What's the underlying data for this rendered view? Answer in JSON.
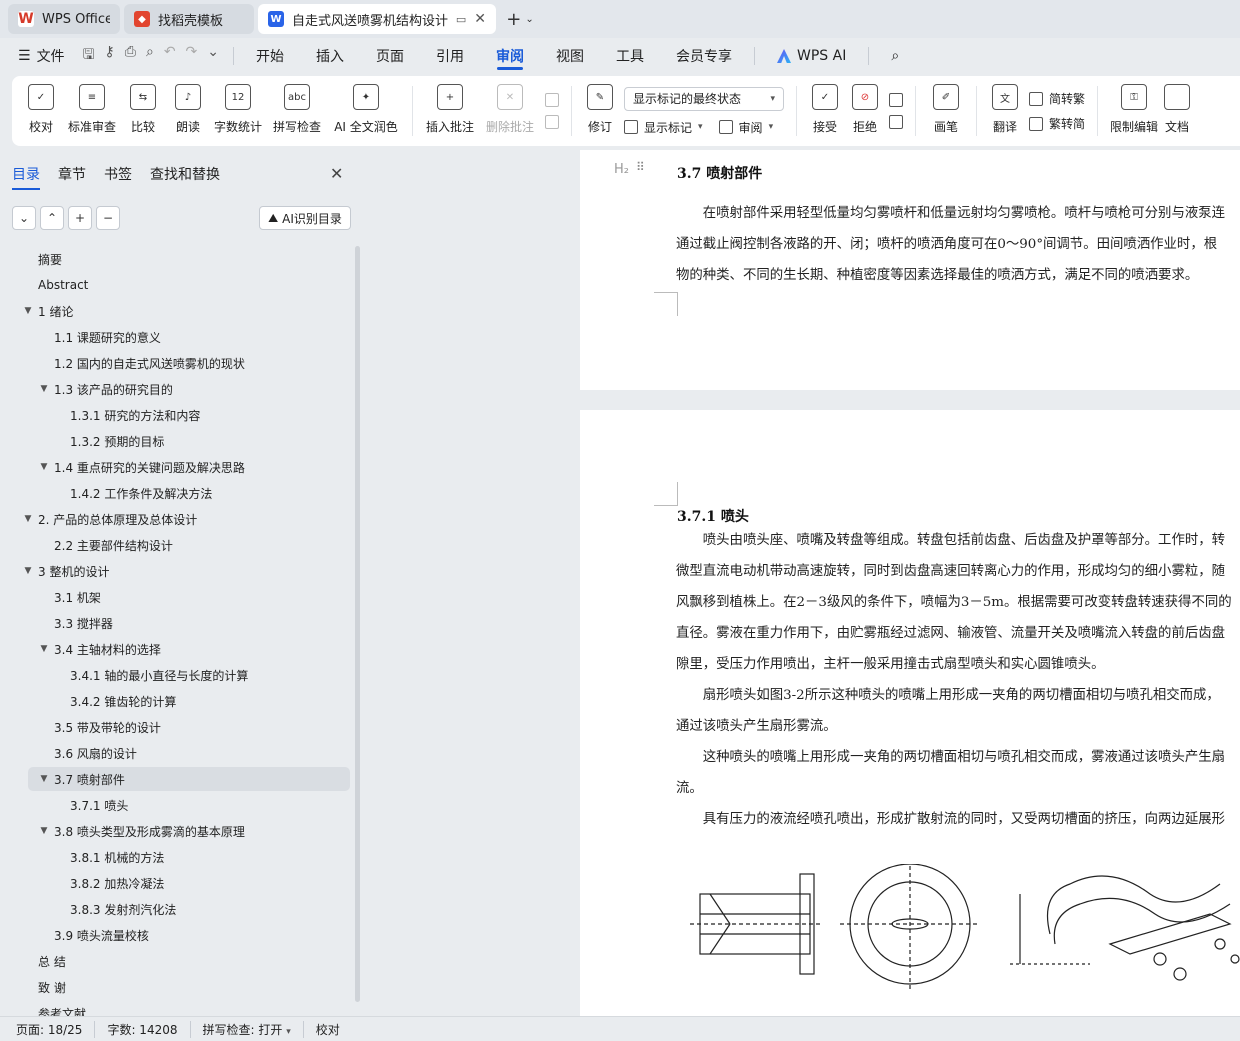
{
  "tabs": [
    {
      "label": "WPS Office",
      "icon": "wps-logo-icon"
    },
    {
      "label": "找稻壳模板",
      "icon": "docer-icon"
    },
    {
      "label": "自走式风送喷雾机结构设计 说",
      "icon": "word-doc-icon"
    }
  ],
  "menu": {
    "file": "文件",
    "items": [
      "开始",
      "插入",
      "页面",
      "引用",
      "审阅",
      "视图",
      "工具",
      "会员专享"
    ],
    "active": "审阅",
    "wps_ai": "WPS AI"
  },
  "ribbon": {
    "proofread": "校对",
    "standard_review": "标准审查",
    "compare": "比较",
    "read_aloud": "朗读",
    "word_count": "字数统计",
    "spell_check": "拼写检查",
    "ai_polish": "AI 全文润色",
    "insert_comment": "插入批注",
    "delete_comment": "删除批注",
    "revise": "修订",
    "markup_mode": "显示标记的最终状态",
    "show_markup": "显示标记",
    "review": "审阅",
    "accept": "接受",
    "reject": "拒绝",
    "pen": "画笔",
    "translate": "翻译",
    "to_traditional": "简转繁",
    "to_simplified": "繁转简",
    "restrict_edit": "限制编辑",
    "doc_more": "文档"
  },
  "nav": {
    "tabs": [
      "目录",
      "章节",
      "书签",
      "查找和替换"
    ],
    "active_tab": "目录",
    "ai_toc": "AI识别目录",
    "toc": [
      {
        "label": "摘要",
        "level": 0,
        "toggle": ""
      },
      {
        "label": "Abstract",
        "level": 0,
        "toggle": ""
      },
      {
        "label": "1  绪论",
        "level": 0,
        "toggle": "▼"
      },
      {
        "label": "1.1 课题研究的意义",
        "level": 1,
        "toggle": ""
      },
      {
        "label": "1.2 国内的自走式风送喷雾机的现状",
        "level": 1,
        "toggle": ""
      },
      {
        "label": "1.3  该产品的研究目的",
        "level": 1,
        "toggle": "▼"
      },
      {
        "label": "1.3.1  研究的方法和内容",
        "level": 2,
        "toggle": ""
      },
      {
        "label": "1.3.2 预期的目标",
        "level": 2,
        "toggle": ""
      },
      {
        "label": "1.4 重点研究的关键问题及解决思路",
        "level": 1,
        "toggle": "▼"
      },
      {
        "label": "1.4.2 工作条件及解决方法",
        "level": 2,
        "toggle": ""
      },
      {
        "label": "2.  产品的总体原理及总体设计",
        "level": 0,
        "toggle": "▼"
      },
      {
        "label": "2.2  主要部件结构设计",
        "level": 1,
        "toggle": ""
      },
      {
        "label": "3  整机的设计",
        "level": 0,
        "toggle": "▼"
      },
      {
        "label": "3.1  机架",
        "level": 1,
        "toggle": ""
      },
      {
        "label": "3.3  搅拌器",
        "level": 1,
        "toggle": ""
      },
      {
        "label": "3.4  主轴材料的选择",
        "level": 1,
        "toggle": "▼"
      },
      {
        "label": "3.4.1  轴的最小直径与长度的计算",
        "level": 2,
        "toggle": ""
      },
      {
        "label": "3.4.2  锥齿轮的计算",
        "level": 2,
        "toggle": ""
      },
      {
        "label": "3.5  带及带轮的设计",
        "level": 1,
        "toggle": ""
      },
      {
        "label": "3.6  风扇的设计",
        "level": 1,
        "toggle": ""
      },
      {
        "label": "3.7 喷射部件",
        "level": 1,
        "toggle": "▼",
        "selected": true
      },
      {
        "label": "3.7.1  喷头",
        "level": 2,
        "toggle": ""
      },
      {
        "label": "3.8 喷头类型及形成雾滴的基本原理",
        "level": 1,
        "toggle": "▼"
      },
      {
        "label": "3.8.1  机械的方法",
        "level": 2,
        "toggle": ""
      },
      {
        "label": "3.8.2  加热冷凝法",
        "level": 2,
        "toggle": ""
      },
      {
        "label": "3.8.3  发射剂汽化法",
        "level": 2,
        "toggle": ""
      },
      {
        "label": "3.9  喷头流量校核",
        "level": 1,
        "toggle": ""
      },
      {
        "label": "总  结",
        "level": 0,
        "toggle": ""
      },
      {
        "label": "致  谢",
        "level": 0,
        "toggle": ""
      },
      {
        "label": "参考文献",
        "level": 0,
        "toggle": ""
      }
    ]
  },
  "doc": {
    "heading_marker": "H₂",
    "section_37_title": "3.7 喷射部件",
    "section_37_lines": [
      "　　在喷射部件采用轻型低量均匀雾喷杆和低量远射均匀雾喷枪。喷杆与喷枪可分别与液泵连",
      "通过截止阀控制各液路的开、闭；喷杆的喷洒角度可在0～90°间调节。田间喷洒作业时，根",
      "物的种类、不同的生长期、种植密度等因素选择最佳的喷洒方式，满足不同的喷洒要求。"
    ],
    "section_371_title": "3.7.1  喷头",
    "section_371_lines": [
      "　　喷头由喷头座、喷嘴及转盘等组成。转盘包括前齿盘、后齿盘及护罩等部分。工作时，转",
      "微型直流电动机带动高速旋转，同时到齿盘高速回转离心力的作用，形成均匀的细小雾粒，随",
      "风飘移到植株上。在2－3级风的条件下，喷幅为3－5m。根据需要可改变转盘转速获得不同的",
      "直径。雾液在重力作用下，由贮雾瓶经过滤网、输液管、流量开关及喷嘴流入转盘的前后齿盘",
      "隙里，受压力作用喷出，主杆一般采用撞击式扇型喷头和实心圆锥喷头。",
      "　　扇形喷头如图3-2所示这种喷头的喷嘴上用形成一夹角的两切槽面相切与喷孔相交而成，",
      "通过该喷头产生扇形雾流。",
      "　　这种喷头的喷嘴上用形成一夹角的两切槽面相切与喷孔相交而成，雾液通过该喷头产生扇",
      "流。",
      "　　具有压力的液流经喷孔喷出，形成扩散射流的同时，又受两切槽面的挤压，向两边延展形"
    ]
  },
  "status": {
    "page": "页面: 18/25",
    "words": "字数: 14208",
    "spell": "拼写检查: 打开",
    "proof": "校对"
  }
}
